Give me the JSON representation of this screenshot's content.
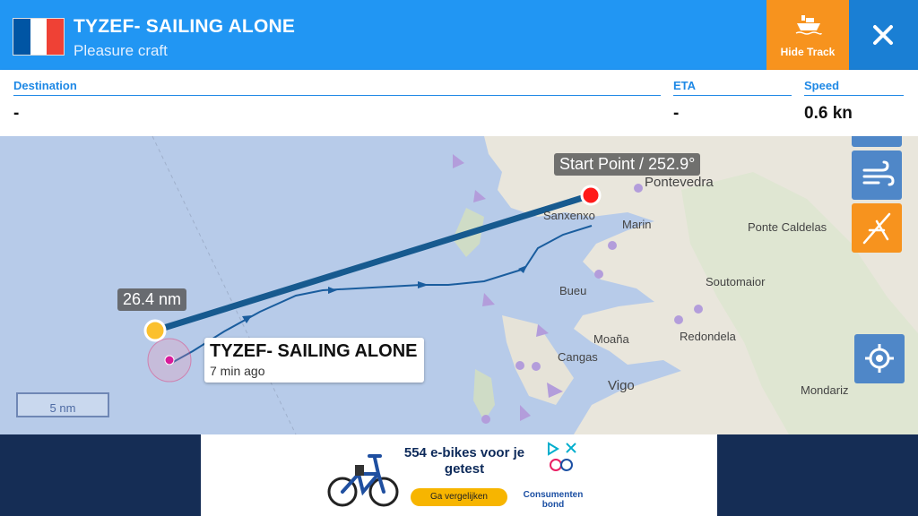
{
  "header": {
    "vessel_name": "TYZEF- SAILING ALONE",
    "vessel_type": "Pleasure craft",
    "hide_track_label": "Hide Track",
    "flag_colors": [
      "#0055a4",
      "#ffffff",
      "#ef4135"
    ]
  },
  "info": {
    "destination_label": "Destination",
    "destination_value": "-",
    "eta_label": "ETA",
    "eta_value": "-",
    "speed_label": "Speed",
    "speed_value": "0.6 kn"
  },
  "map": {
    "start_point_label": "Start Point / 252.9°",
    "distance_label": "26.4 nm",
    "vessel_label_name": "TYZEF- SAILING ALONE",
    "vessel_label_time": "7 min ago",
    "scale_label": "5 nm",
    "places": [
      "Pontevedra",
      "Sanxenxo",
      "Marin",
      "Ponte Caldelas",
      "Soutomaior",
      "Bueu",
      "Moaña",
      "Redondela",
      "Cangas",
      "Vigo",
      "Mondariz"
    ]
  },
  "ad": {
    "headline": "554 e-bikes voor je getest",
    "cta": "Ga vergelijken",
    "brand": "Consumenten bond"
  }
}
